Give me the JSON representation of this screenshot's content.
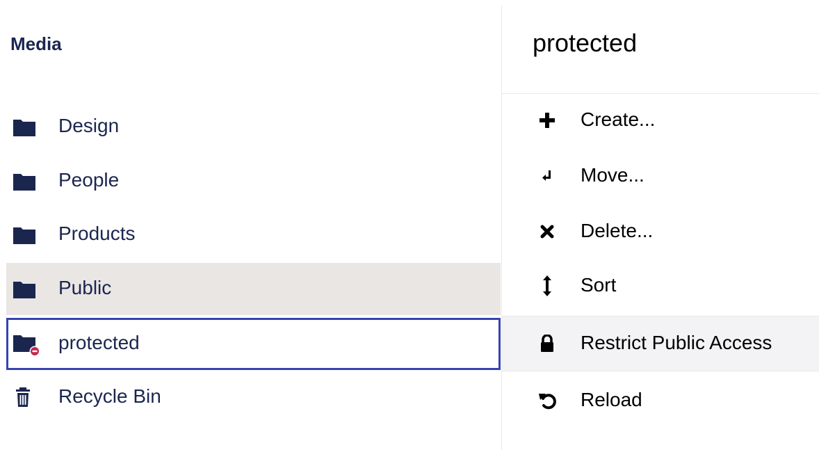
{
  "tree": {
    "title": "Media",
    "items": [
      {
        "label": "Design",
        "icon": "folder-icon"
      },
      {
        "label": "People",
        "icon": "folder-icon"
      },
      {
        "label": "Products",
        "icon": "folder-icon"
      },
      {
        "label": "Public",
        "icon": "folder-icon",
        "state": "selected"
      },
      {
        "label": "protected",
        "icon": "protected-folder-icon",
        "state": "focused"
      },
      {
        "label": "Recycle Bin",
        "icon": "trash-icon"
      }
    ]
  },
  "actions": {
    "title": "protected",
    "items": [
      {
        "label": "Create...",
        "icon": "plus-icon"
      },
      {
        "label": "Move...",
        "icon": "move-icon"
      },
      {
        "label": "Delete...",
        "icon": "delete-icon"
      },
      {
        "label": "Sort",
        "icon": "sort-icon"
      },
      {
        "label": "Restrict Public Access",
        "icon": "lock-icon",
        "state": "highlighted"
      },
      {
        "label": "Reload",
        "icon": "reload-icon"
      }
    ]
  },
  "colors": {
    "text": "#1b264f",
    "selected_bg": "#e9e6e4",
    "focus_border": "#3544b1",
    "highlight_bg": "#f3f3f5",
    "restricted_badge": "#c1284e"
  }
}
